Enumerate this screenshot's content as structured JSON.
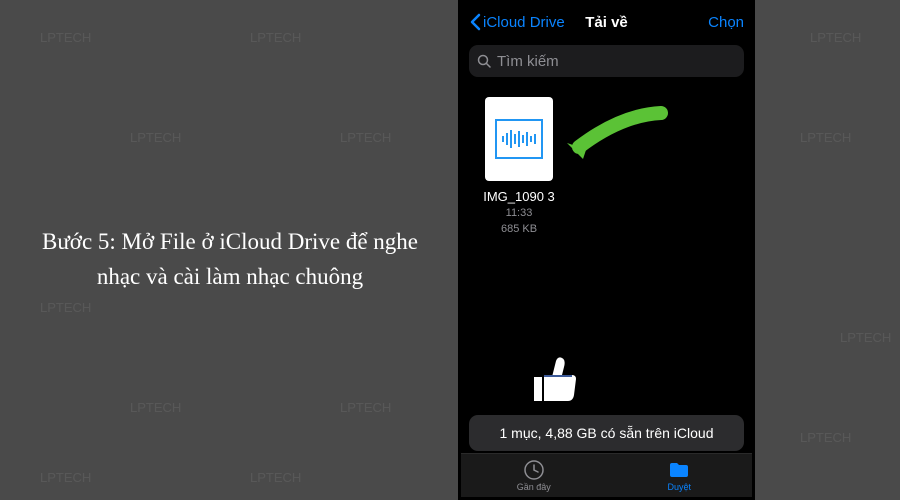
{
  "instruction": "Bước 5: Mở File ở iCloud Drive để nghe nhạc và cài làm nhạc chuông",
  "nav": {
    "back": "iCloud Drive",
    "title": "Tải về",
    "action": "Chọn"
  },
  "search": {
    "placeholder": "Tìm kiếm"
  },
  "file": {
    "name": "IMG_1090 3",
    "time": "11:33",
    "size": "685 KB"
  },
  "storage": "1 mục, 4,88 GB có sẵn trên iCloud",
  "tabs": {
    "recent": "Gần đây",
    "browse": "Duyệt"
  },
  "watermark": "LPTECH"
}
